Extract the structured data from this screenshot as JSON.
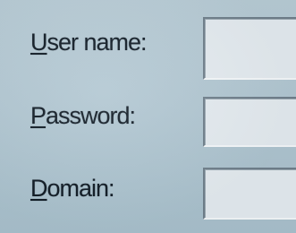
{
  "login_form": {
    "username": {
      "label_accel": "U",
      "label_rest": "ser name:",
      "value": ""
    },
    "password": {
      "label_accel": "P",
      "label_rest": "assword:",
      "value": ""
    },
    "domain": {
      "label_accel": "D",
      "label_rest": "omain:",
      "value": ""
    }
  }
}
